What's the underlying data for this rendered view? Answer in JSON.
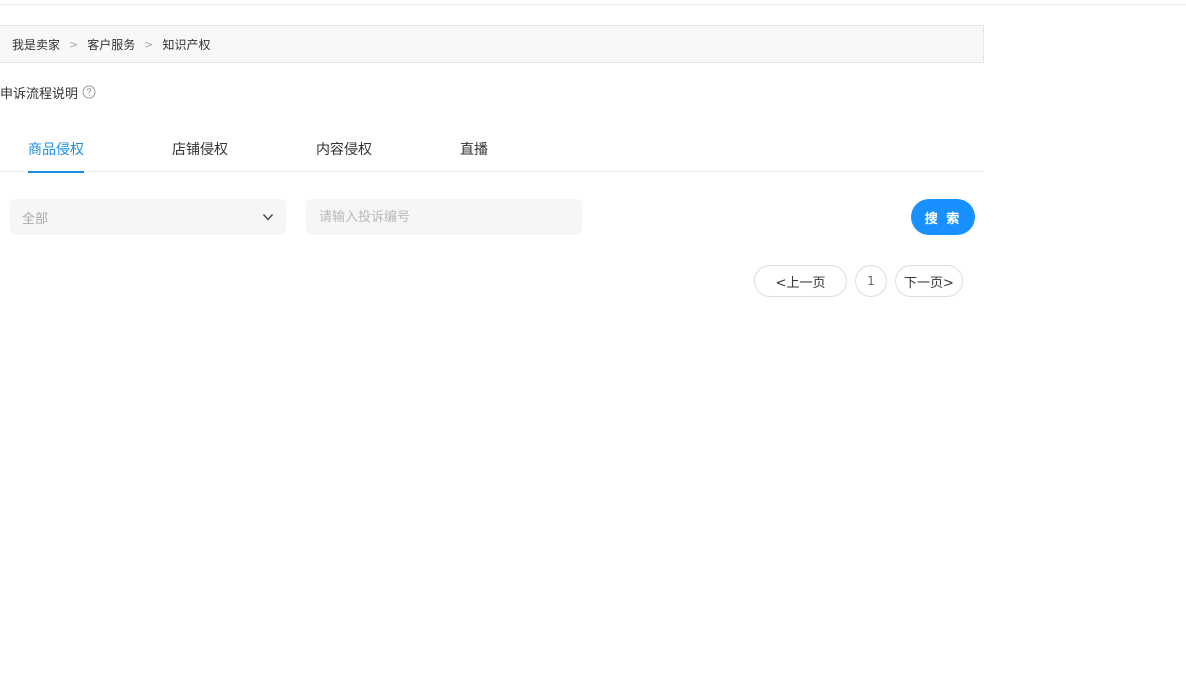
{
  "breadcrumb": {
    "items": [
      "我是卖家",
      "客户服务",
      "知识产权"
    ],
    "separator": ">"
  },
  "process": {
    "label": "申诉流程说明",
    "icon": "question-circle-icon"
  },
  "tabs": [
    {
      "label": "商品侵权",
      "active": true
    },
    {
      "label": "店铺侵权",
      "active": false
    },
    {
      "label": "内容侵权",
      "active": false
    },
    {
      "label": "直播",
      "active": false
    }
  ],
  "filter": {
    "select_value": "全部",
    "select_icon": "chevron-down-icon",
    "search_placeholder": "请输入投诉编号",
    "search_button": "搜 索"
  },
  "pagination": {
    "prev_label": "<上一页",
    "current_page": "1",
    "next_label": "下一页>"
  },
  "colors": {
    "accent": "#1890ff",
    "tab_active": "#1a8fe3"
  }
}
